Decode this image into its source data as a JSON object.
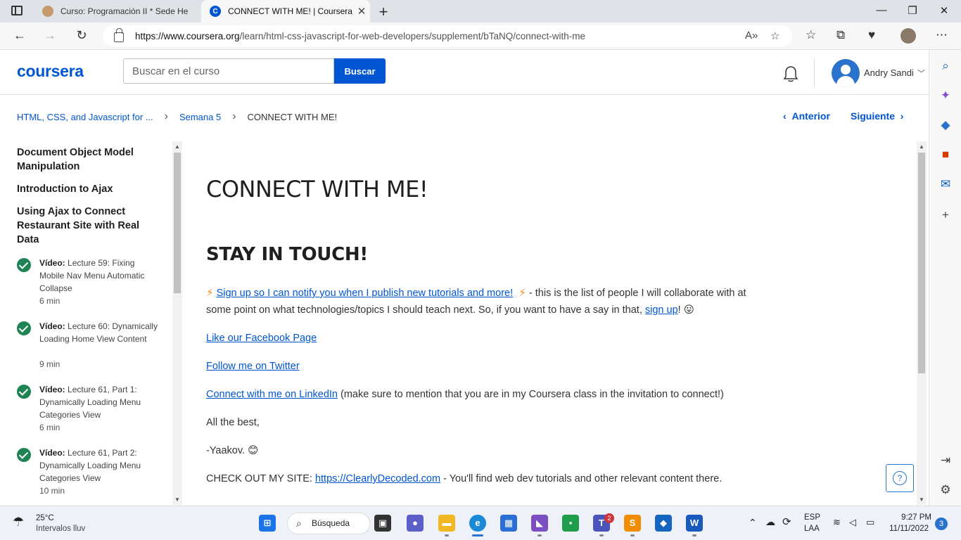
{
  "browser": {
    "tabs": [
      {
        "title": "Curso: Programación II * Sede He",
        "active": false
      },
      {
        "title": "CONNECT WITH ME! | Coursera",
        "active": true
      }
    ],
    "new_tab": "+",
    "url_host": "https://www.coursera.org",
    "url_path": "/learn/html-css-javascript-for-web-developers/supplement/bTaNQ/connect-with-me"
  },
  "header": {
    "logo": "coursera",
    "search_placeholder": "Buscar en el curso",
    "search_button": "Buscar",
    "user_name": "Andry Sandi"
  },
  "breadcrumb": {
    "course": "HTML, CSS, and Javascript for ...",
    "week": "Semana 5",
    "current": "CONNECT WITH ME!"
  },
  "pager": {
    "prev": "Anterior",
    "next": "Siguiente"
  },
  "left_nav": {
    "headings": [
      "Document Object Model Manipulation",
      "Introduction to Ajax",
      "Using Ajax to Connect Restaurant Site with Real Data"
    ],
    "items": [
      {
        "kind": "Vídeo:",
        "title": "Lecture 59: Fixing Mobile Nav Menu Automatic Collapse",
        "duration": "6 min",
        "completed": true
      },
      {
        "kind": "Vídeo:",
        "title": "Lecture 60: Dynamically Loading Home View Content",
        "duration": "9 min",
        "completed": true
      },
      {
        "kind": "Vídeo:",
        "title": "Lecture 61, Part 1: Dynamically Loading Menu Categories View",
        "duration": "6 min",
        "completed": true
      },
      {
        "kind": "Vídeo:",
        "title": "Lecture 61, Part 2: Dynamically Loading Menu Categories View",
        "duration": "10 min",
        "completed": true
      }
    ]
  },
  "content": {
    "page_title": "CONNECT WITH ME!",
    "subtitle": "STAY IN TOUCH!",
    "signup_link": "Sign up so I can notify you when I publish new tutorials and more!",
    "signup_text": " - this is the list of people I will collaborate with at some point on what technologies/topics I should teach next. So, if you want to have a say in that, ",
    "signup_short": "sign up",
    "signup_end": "! 😛",
    "facebook": "Like our Facebook Page",
    "twitter": "Follow me on Twitter",
    "linkedin": "Connect with me on LinkedIn",
    "linkedin_note": " (make sure to mention that you are in my Coursera class in the invitation to connect!)",
    "regards": "All the best,",
    "signature": "-Yaakov. 😊",
    "site_prefix": "CHECK OUT MY SITE: ",
    "site_link": "https://ClearlyDecoded.com",
    "site_suffix": " - You'll find web dev tutorials and other relevant content there."
  },
  "help": "?",
  "taskbar": {
    "temp": "25°C",
    "weather": "Intervalos lluv",
    "search": "Búsqueda",
    "lang1": "ESP",
    "lang2": "LAA",
    "time": "9:27 PM",
    "date": "11/11/2022",
    "notif": "3",
    "teams_badge": "2"
  },
  "colors": {
    "accent": "#0056d2",
    "complete": "#1f8354"
  }
}
